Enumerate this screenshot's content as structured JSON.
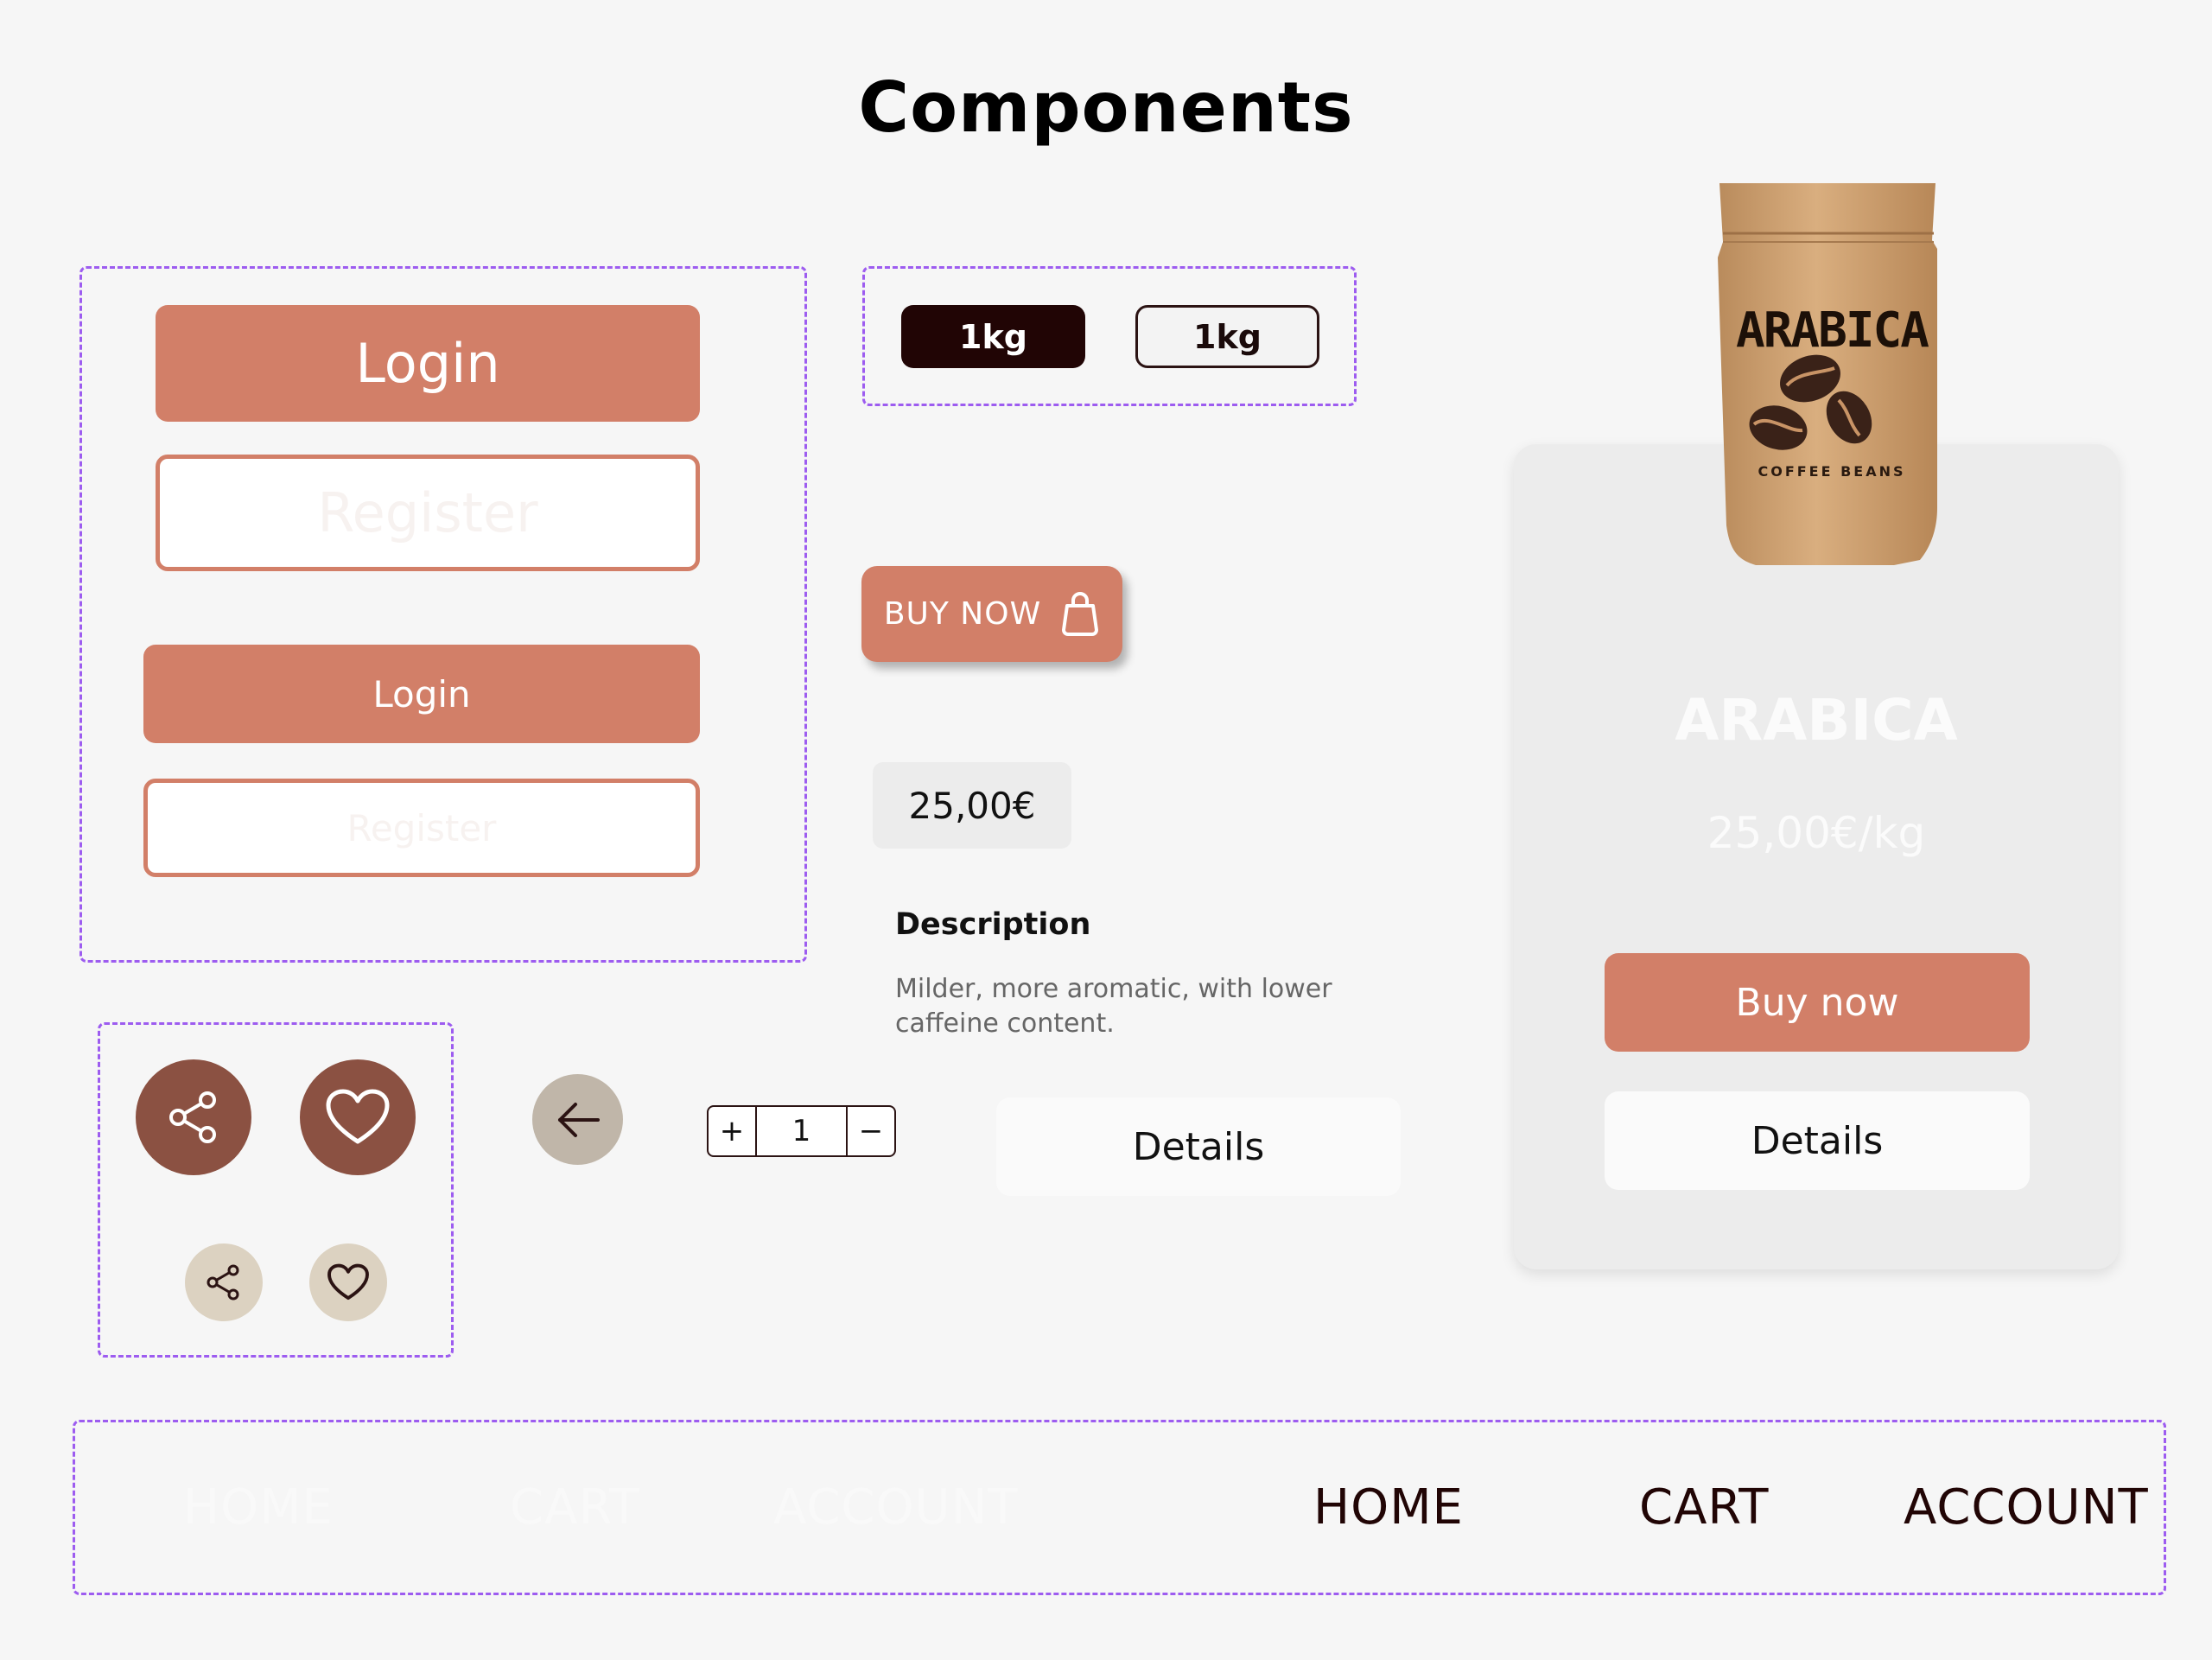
{
  "page": {
    "title": "Components"
  },
  "auth_buttons": {
    "login_large": "Login",
    "register_large": "Register",
    "login_small": "Login",
    "register_small": "Register"
  },
  "weight_chips": {
    "selected": "1kg",
    "unselected": "1kg"
  },
  "buy_now": {
    "label": "BUY NOW",
    "icon": "shopping-bag-icon"
  },
  "price": {
    "value": "25,00€"
  },
  "description": {
    "heading": "Description",
    "text": "Milder, more aromatic, with lower caffeine content."
  },
  "icons": {
    "share_large": "share-icon",
    "heart_large": "heart-icon",
    "share_small": "share-icon",
    "heart_small": "heart-icon",
    "back": "arrow-left-icon"
  },
  "quantity": {
    "plus": "+",
    "value": "1",
    "minus": "−"
  },
  "details_button": {
    "label": "Details"
  },
  "product_card": {
    "bag_brand": "ARABICA",
    "bag_subtitle": "COFFEE BEANS",
    "title": "ARABICA",
    "price": "25,00€/kg",
    "buy_label": "Buy now",
    "details_label": "Details"
  },
  "nav_light": {
    "home": "HOME",
    "cart": "CART",
    "account": "ACCOUNT"
  },
  "nav_dark": {
    "home": "HOME",
    "cart": "CART",
    "account": "ACCOUNT"
  },
  "colors": {
    "accent": "#d27f68",
    "dark_brown": "#210505",
    "icon_brown": "#8b5142",
    "muted_beige": "#c0b6a9",
    "light_beige": "#dcd2c1",
    "guide": "#9d5cf0"
  }
}
